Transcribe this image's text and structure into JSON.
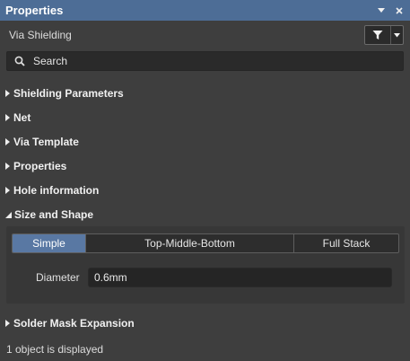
{
  "panel": {
    "title": "Properties",
    "pin_icon": "pin-down-icon",
    "close_icon": "close-icon"
  },
  "header": {
    "object_type": "Via Shielding",
    "filter_icon": "filter-icon",
    "dropdown_icon": "chevron-down-icon"
  },
  "search": {
    "placeholder": "Search",
    "value": ""
  },
  "sections": {
    "shielding_parameters": {
      "label": "Shielding Parameters",
      "expanded": false
    },
    "net": {
      "label": "Net",
      "expanded": false
    },
    "via_template": {
      "label": "Via Template",
      "expanded": false
    },
    "properties": {
      "label": "Properties",
      "expanded": false
    },
    "hole_information": {
      "label": "Hole information",
      "expanded": false
    },
    "size_and_shape": {
      "label": "Size and Shape",
      "expanded": true
    },
    "solder_mask_expansion": {
      "label": "Solder Mask Expansion",
      "expanded": false
    }
  },
  "size_and_shape": {
    "modes": [
      "Simple",
      "Top-Middle-Bottom",
      "Full Stack"
    ],
    "active_mode": "Simple",
    "diameter_label": "Diameter",
    "diameter_value": "0.6mm"
  },
  "status": {
    "text": "1 object is displayed"
  },
  "colors": {
    "titlebar": "#4d6d96",
    "background": "#3e3e3e",
    "active_segment": "#5978a3"
  }
}
